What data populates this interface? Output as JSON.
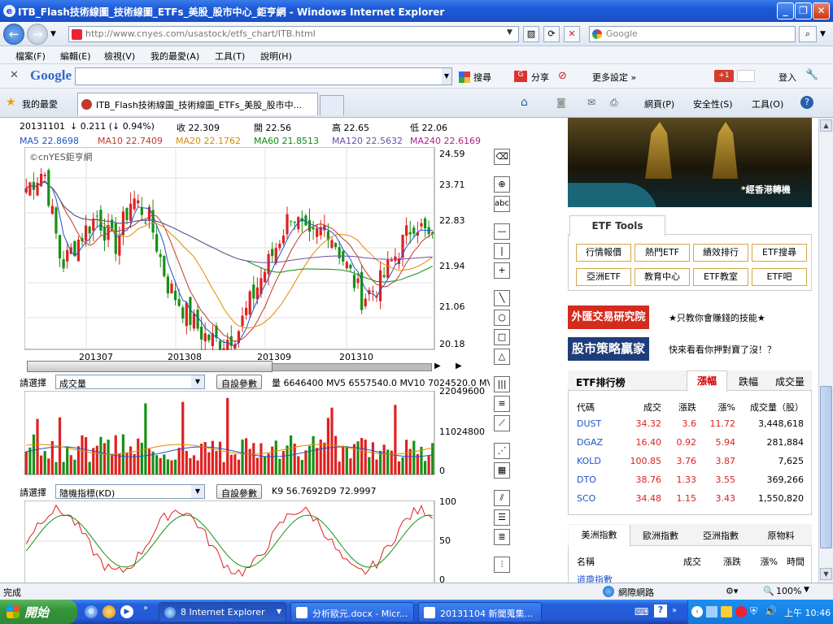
{
  "window": {
    "title": "ITB_Flash技術線圖_技術線圖_ETFs_美股_股市中心_鉅亨網 - Windows Internet Explorer"
  },
  "address": {
    "url": "http://www.cnyes.com/usastock/etfs_chart/ITB.html",
    "search_placeholder": "Google"
  },
  "menu": [
    "檔案(F)",
    "編輯(E)",
    "檢視(V)",
    "我的最愛(A)",
    "工具(T)",
    "說明(H)"
  ],
  "google_bar": {
    "brand": "Google",
    "search": "搜尋",
    "share": "分享",
    "more": "更多設定 »",
    "login": "登入",
    "gplus": "+1"
  },
  "tabs": {
    "favorites": "我的最愛",
    "active": "ITB_Flash技術線圖_技術線圖_ETFs_美股_股市中..."
  },
  "commands": {
    "page": "網頁(P)",
    "safety": "安全性(S)",
    "tools": "工具(O)"
  },
  "quote": {
    "date": "20131101",
    "change": "↓ 0.211 (↓ 0.94%)",
    "close": "收 22.309",
    "open": "開 22.56",
    "high": "高 22.65",
    "low": "低 22.06"
  },
  "ma": [
    {
      "label": "MA5 22.8698",
      "color": "#1f55c8"
    },
    {
      "label": "MA10 22.7409",
      "color": "#c0392b"
    },
    {
      "label": "MA20 22.1762",
      "color": "#e08a00"
    },
    {
      "label": "MA60 21.8513",
      "color": "#118a11"
    },
    {
      "label": "MA120 22.5632",
      "color": "#6b4fa8"
    },
    {
      "label": "MA240 22.6169",
      "color": "#b51f8c"
    }
  ],
  "chart_watermark": "©cnYES鉅亨網",
  "price_axis": [
    "24.59",
    "23.71",
    "22.83",
    "21.94",
    "21.06",
    "20.18"
  ],
  "months": [
    "201307",
    "201308",
    "201309",
    "201310"
  ],
  "volume": {
    "select_label": "請選擇",
    "select_value": "成交量",
    "button": "自設參數",
    "info": "量 6646400  MV5 6557540.0  MV10 7024520.0  MV20 7",
    "axis": [
      "22049600",
      "11024800",
      "0"
    ]
  },
  "kd": {
    "select_label": "請選擇",
    "select_value": "隨機指標(KD)",
    "button": "自設參數",
    "k": "K9 56.7692",
    "d": "D9 72.9997",
    "axis": [
      "100",
      "50",
      "0"
    ]
  },
  "banner": {
    "caption": "*經香港轉機"
  },
  "etf_tools": {
    "title": "ETF Tools",
    "buttons": [
      "行情報價",
      "熱門ETF",
      "績效排行",
      "ETF搜尋",
      "亞洲ETF",
      "教育中心",
      "ETF教室",
      "ETF吧"
    ]
  },
  "ads": [
    {
      "badge": "外匯交易研究院",
      "text": "★只教你會賺錢的技能★",
      "color": "#d52a1e"
    },
    {
      "badge": "股市策略贏家",
      "text": "快來看看你押對寶了沒！？",
      "color": "#1f3d7a"
    }
  ],
  "ranking": {
    "title": "ETF排行榜",
    "tabs": [
      "漲幅",
      "跌幅",
      "成交量"
    ],
    "headers": [
      "代碼",
      "成交",
      "漲跌",
      "漲%",
      "成交量（股）"
    ],
    "rows": [
      [
        "DUST",
        "34.32",
        "3.6",
        "11.72",
        "3,448,618"
      ],
      [
        "DGAZ",
        "16.40",
        "0.92",
        "5.94",
        "281,884"
      ],
      [
        "KOLD",
        "100.85",
        "3.76",
        "3.87",
        "7,625"
      ],
      [
        "DTO",
        "38.76",
        "1.33",
        "3.55",
        "369,266"
      ],
      [
        "SCO",
        "34.48",
        "1.15",
        "3.43",
        "1,550,820"
      ]
    ]
  },
  "index": {
    "tabs": [
      "美洲指數",
      "歐洲指數",
      "亞洲指數",
      "原物料"
    ],
    "headers": [
      "名稱",
      "成交",
      "漲跌",
      "漲%",
      "時間"
    ],
    "row_name": "道瓊指數"
  },
  "status": {
    "text": "完成",
    "zone": "網際網路",
    "zoom": "100%"
  },
  "taskbar": {
    "start": "開始",
    "tasks": [
      "8 Internet Explorer",
      "分析歐元.docx - Micr...",
      "20131104 新聞蒐集..."
    ],
    "time": "上午 10:46"
  },
  "colors": {
    "up": "#e02020",
    "down": "#169016"
  }
}
